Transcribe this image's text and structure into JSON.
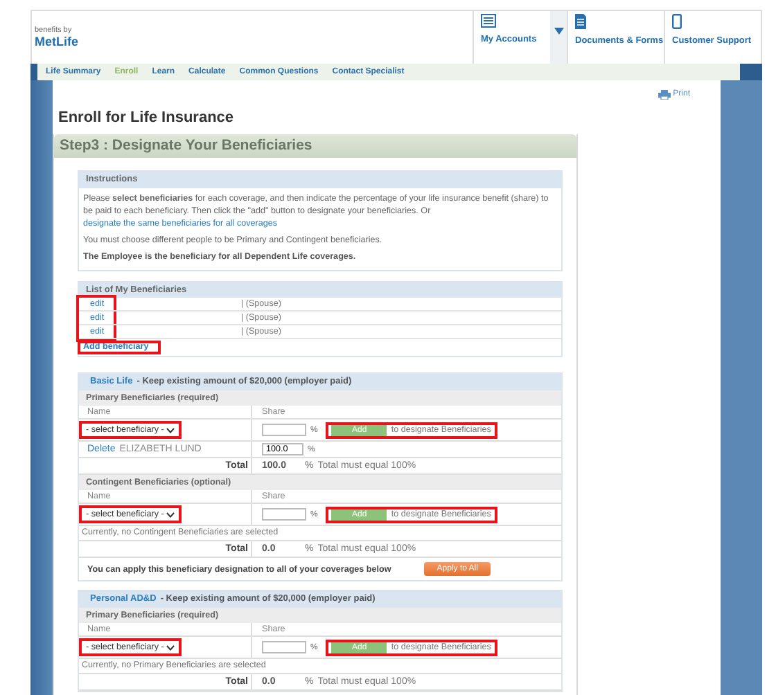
{
  "header": {
    "logo_tagline": "benefits by",
    "logo": "MetLife",
    "nav": [
      {
        "label": "My Accounts",
        "dropdown": true
      },
      {
        "label": "Documents & Forms",
        "dropdown": false
      },
      {
        "label": "Customer Support",
        "dropdown": false
      }
    ]
  },
  "subnav": [
    {
      "label": "Life Summary",
      "selected": false
    },
    {
      "label": "Enroll",
      "selected": true
    },
    {
      "label": "Learn",
      "selected": false
    },
    {
      "label": "Calculate",
      "selected": false
    },
    {
      "label": "Common Questions",
      "selected": false
    },
    {
      "label": "Contact Specialist",
      "selected": false
    }
  ],
  "print_link": "Print",
  "page_title": "Enroll for Life Insurance",
  "step_title": "Step3 : Designate Your Beneficiaries",
  "instructions": {
    "title": "Instructions",
    "paragraphs": [
      {
        "text": "Please **select beneficiaries** for each coverage, and then indicate the percentage of your life insurance benefit (share) to be paid to each beneficiary. Then click the \"add\" button to designate your beneficiaries. Or",
        "link": "designate the same beneficiaries for all coverages",
        "bold": false
      },
      {
        "text": "You must choose different people to be Primary and Contingent beneficiaries.",
        "bold": false
      },
      {
        "text": "The Employee is the beneficiary for all Dependent Life coverages.",
        "bold": true
      }
    ]
  },
  "beneficiaries": {
    "title": "List of My Beneficiaries",
    "edit_links_highlighted": true,
    "rows": [
      {
        "action": "edit",
        "relation": "| (Spouse)"
      },
      {
        "action": "edit",
        "relation": "| (Spouse)"
      },
      {
        "action": "edit",
        "relation": "| (Spouse)"
      }
    ],
    "add_link": {
      "label": "Add beneficiary",
      "highlighted": true
    }
  },
  "coverages": [
    {
      "name": "Basic Life",
      "description": "- Keep existing amount of $20,000 (employer paid)",
      "groups": [
        {
          "title": "Primary Beneficiaries (required)",
          "columns": [
            "Name",
            "Share"
          ],
          "select": {
            "value": "- select beneficiary -",
            "highlighted": true
          },
          "share_unit": "%",
          "add_button": "Add",
          "add_hint": "to designate Beneficiaries",
          "add_highlighted": true,
          "entries": [
            {
              "action": "Delete",
              "name": "ELIZABETH LUND",
              "share": "100.0",
              "unit": "%"
            }
          ],
          "total_label": "Total",
          "total": "100.0",
          "total_unit": "%",
          "total_note": "Total must equal 100%"
        },
        {
          "title": "Contingent Beneficiaries (optional)",
          "columns": [
            "Name",
            "Share"
          ],
          "select": {
            "value": "- select beneficiary -",
            "highlighted": true
          },
          "share_unit": "%",
          "add_button": "Add",
          "add_hint": "to designate Beneficiaries",
          "add_highlighted": true,
          "empty_note": "Currently, no Contingent Beneficiaries are selected",
          "total_label": "Total",
          "total": "0.0",
          "total_unit": "%",
          "total_note": "Total must equal 100%"
        }
      ],
      "apply": {
        "text": "You can apply this beneficiary designation to all of your coverages below",
        "button": "Apply to All"
      }
    },
    {
      "name": "Personal AD&D",
      "description": "- Keep existing amount of $20,000 (employer paid)",
      "groups": [
        {
          "title": "Primary Beneficiaries (required)",
          "columns": [
            "Name",
            "Share"
          ],
          "select": {
            "value": "- select beneficiary -",
            "highlighted": true
          },
          "share_unit": "%",
          "add_button": "Add",
          "add_hint": "to designate Beneficiaries",
          "add_highlighted": true,
          "empty_note": "Currently, no Primary Beneficiaries are selected",
          "total_label": "Total",
          "total": "0.0",
          "total_unit": "%",
          "total_note": "Total must equal 100%"
        }
      ]
    }
  ]
}
